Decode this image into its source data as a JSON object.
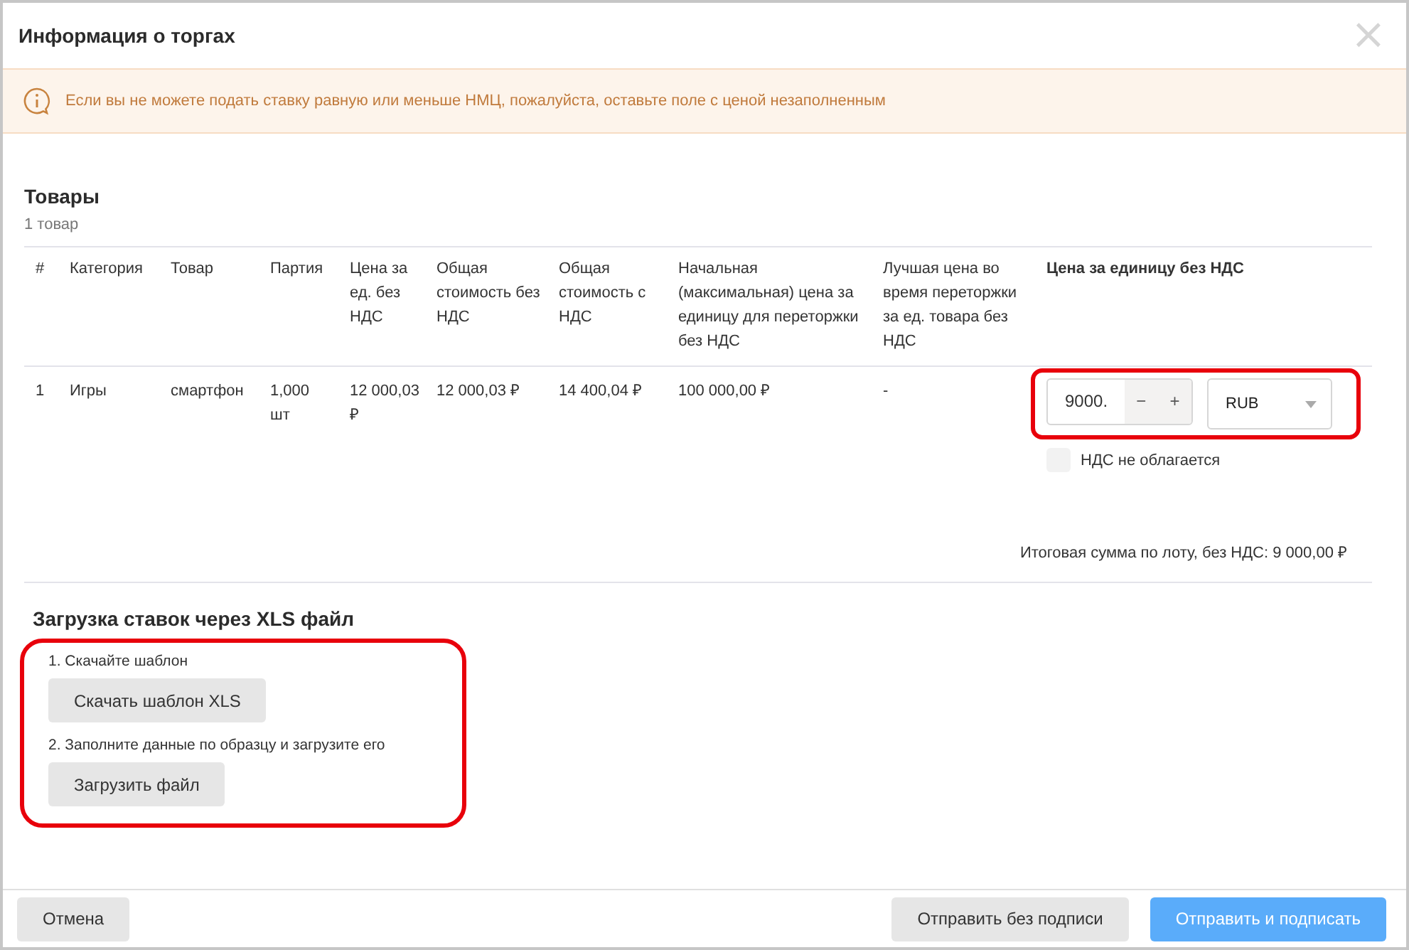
{
  "dialog": {
    "title": "Информация о торгах",
    "close_icon": "×"
  },
  "alert": {
    "text": "Если вы не можете подать ставку равную или меньше НМЦ, пожалуйста, оставьте поле с ценой незаполненным"
  },
  "products": {
    "title": "Товары",
    "count": "1 товар",
    "table": {
      "columns": [
        "#",
        "Категория",
        "Товар",
        "Партия",
        "Цена за ед. без НДС",
        "Общая стоимость без НДС",
        "Общая стоимость с НДС",
        "Начальная (максимальная) цена за единицу для переторжки без НДС",
        "Лучшая цена во время переторжки за ед. товара без НДС",
        "Цена за единицу без НДС"
      ],
      "rows": [
        {
          "cells": [
            "1",
            "Игры",
            "смартфон",
            "1,000 шт",
            "12 000,03 ₽",
            "12 000,03 ₽",
            "14 400,04 ₽",
            "100 000,00 ₽",
            "-"
          ],
          "price": {
            "value": "9000.",
            "minus": "−",
            "plus": "+",
            "currency": "RUB",
            "highlighted": true
          },
          "vat_exempt": {
            "label": "НДС не облагается",
            "checked": false
          }
        }
      ]
    },
    "total": "Итоговая сумма по лоту, без НДС: 9 000,00 ₽"
  },
  "xls_upload": {
    "title": "Загрузка ставок через XLS файл",
    "highlighted": true,
    "steps": [
      {
        "label": "1. Скачайте шаблон",
        "button": "Скачать шаблон XLS"
      },
      {
        "label": "2. Заполните данные по образцу и загрузите его",
        "button": "Загрузить файл"
      }
    ]
  },
  "footer": {
    "buttons": [
      {
        "label": "Отмена",
        "kind": "secondary"
      },
      {
        "label": "Отправить без подписи",
        "kind": "secondary"
      },
      {
        "label": "Отправить и подписать",
        "kind": "primary"
      }
    ]
  }
}
